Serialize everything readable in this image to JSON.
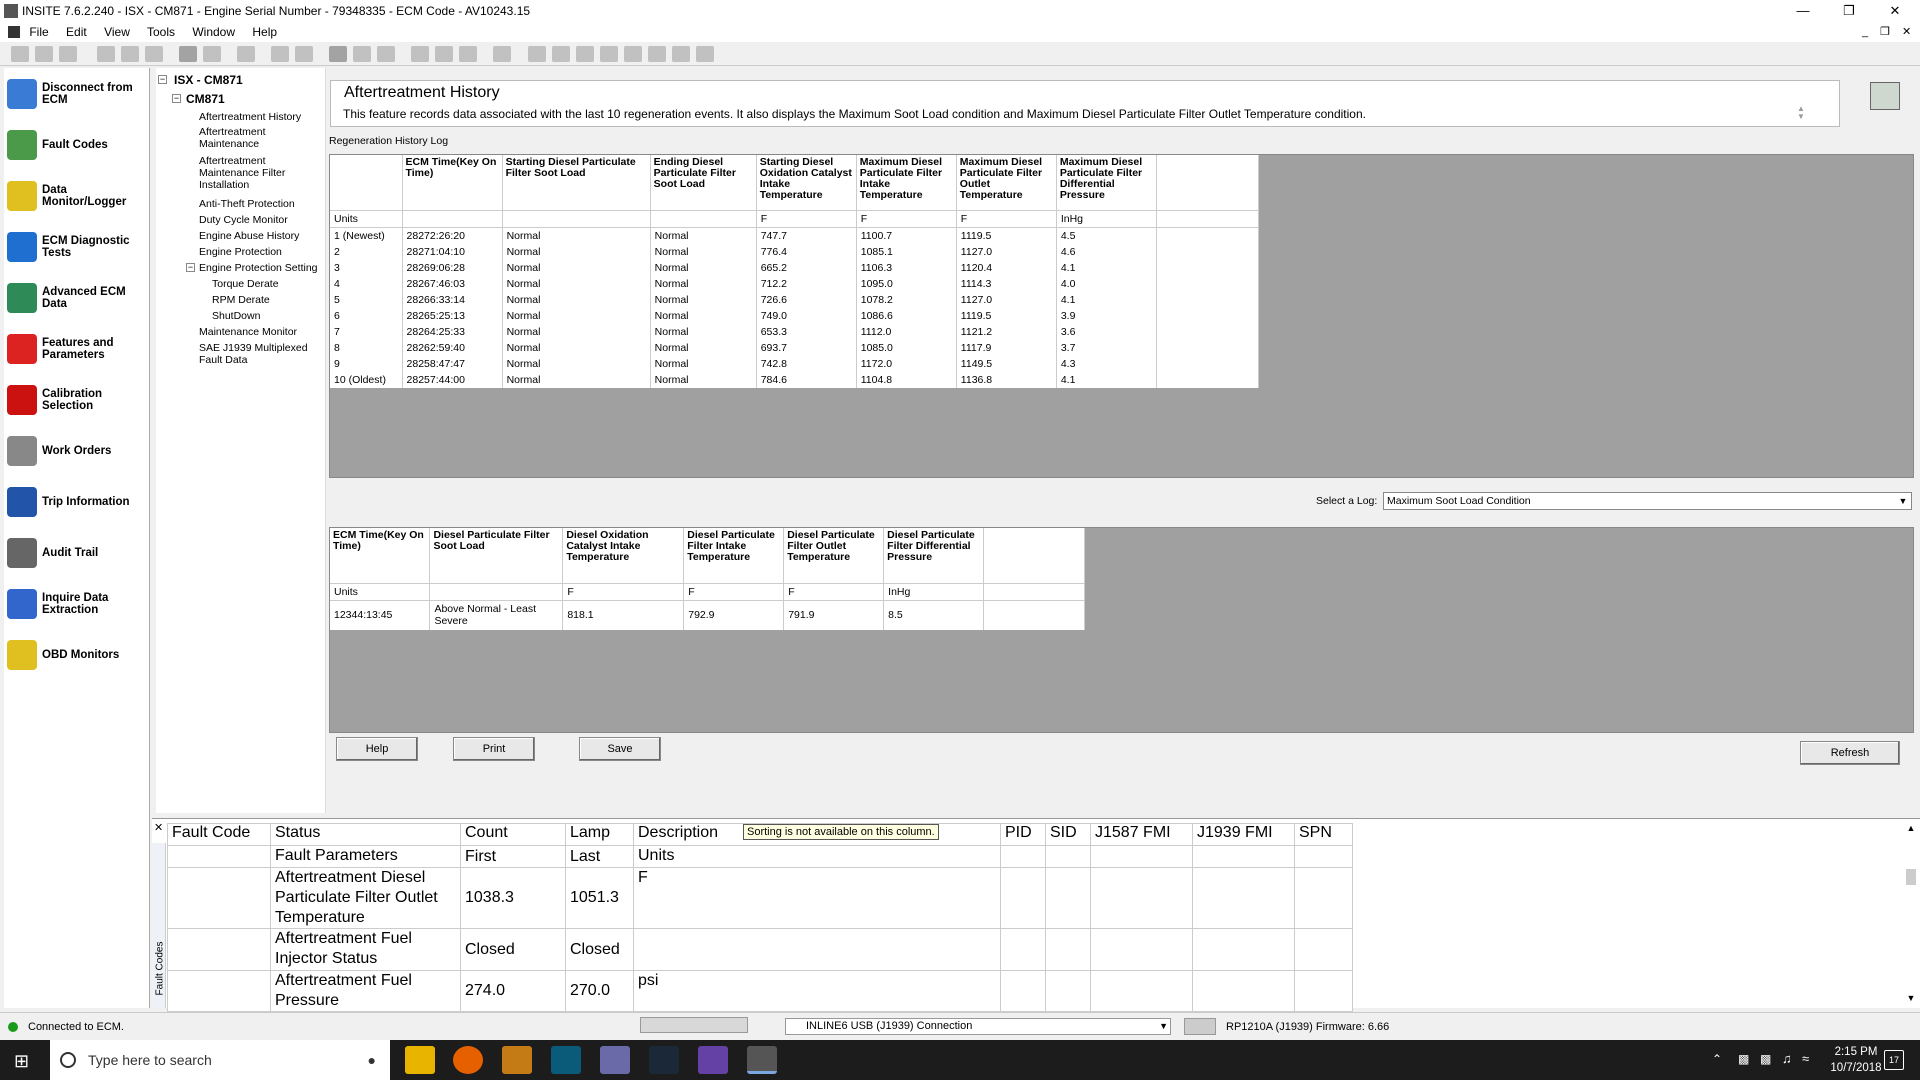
{
  "window": {
    "title": "INSITE 7.6.2.240 - ISX - CM871 - Engine Serial Number - 79348335 - ECM Code - AV10243.15"
  },
  "menu": [
    "File",
    "Edit",
    "View",
    "Tools",
    "Window",
    "Help"
  ],
  "nav": [
    {
      "label": "Disconnect from ECM",
      "icon": "disconnect-icon",
      "color": "#3a7bd5"
    },
    {
      "label": "Fault Codes",
      "icon": "fault-codes-icon",
      "color": "#4a9a4a"
    },
    {
      "label": "Data Monitor/Logger",
      "icon": "data-monitor-icon",
      "color": "#e0c020"
    },
    {
      "label": "ECM Diagnostic Tests",
      "icon": "diagnostic-tests-icon",
      "color": "#1f6fd1"
    },
    {
      "label": "Advanced ECM Data",
      "icon": "advanced-ecm-icon",
      "color": "#2e8b57"
    },
    {
      "label": "Features and Parameters",
      "icon": "features-icon",
      "color": "#d22"
    },
    {
      "label": "Calibration Selection",
      "icon": "calibration-icon",
      "color": "#c11"
    },
    {
      "label": "Work Orders",
      "icon": "work-orders-icon",
      "color": "#888"
    },
    {
      "label": "Trip Information",
      "icon": "trip-info-icon",
      "color": "#2255aa"
    },
    {
      "label": "Audit Trail",
      "icon": "audit-trail-icon",
      "color": "#666"
    },
    {
      "label": "Inquire Data Extraction",
      "icon": "inquire-icon",
      "color": "#3366cc"
    },
    {
      "label": "OBD Monitors",
      "icon": "obd-icon",
      "color": "#e0c020"
    }
  ],
  "tree": {
    "root": "ISX - CM871",
    "child": "CM871",
    "items": [
      "Aftertreatment History",
      "Aftertreatment Maintenance",
      "Aftertreatment Maintenance Filter Installation",
      "Anti-Theft Protection",
      "Duty Cycle Monitor",
      "Engine Abuse History",
      "Engine Protection",
      "Engine Protection Setting",
      "Torque Derate",
      "RPM Derate",
      "ShutDown",
      "Maintenance Monitor",
      "SAE J1939 Multiplexed Fault Data"
    ]
  },
  "page": {
    "title": "Aftertreatment History",
    "desc": "This feature records data associated with the last 10 regeneration events. It also displays the Maximum Soot Load condition and Maximum Diesel Particulate Filter Outlet Temperature condition.",
    "log_label": "Regeneration History Log",
    "select_label": "Select a Log:",
    "select_value": "Maximum Soot Load Condition"
  },
  "regen": {
    "headers": [
      "",
      "ECM Time(Key On Time)",
      "Starting Diesel Particulate Filter Soot Load",
      "Ending Diesel Particulate Filter Soot Load",
      "Starting Diesel Oxidation Catalyst Intake Temperature",
      "Maximum Diesel Particulate Filter Intake Temperature",
      "Maximum Diesel Particulate Filter Outlet Temperature",
      "Maximum Diesel Particulate Filter Differential Pressure",
      ""
    ],
    "units": [
      "Units",
      "",
      "",
      "",
      "F",
      "F",
      "F",
      "InHg",
      ""
    ],
    "rows": [
      [
        "1 (Newest)",
        "28272:26:20",
        "Normal",
        "Normal",
        "747.7",
        "1100.7",
        "1119.5",
        "4.5"
      ],
      [
        "2",
        "28271:04:10",
        "Normal",
        "Normal",
        "776.4",
        "1085.1",
        "1127.0",
        "4.6"
      ],
      [
        "3",
        "28269:06:28",
        "Normal",
        "Normal",
        "665.2",
        "1106.3",
        "1120.4",
        "4.1"
      ],
      [
        "4",
        "28267:46:03",
        "Normal",
        "Normal",
        "712.2",
        "1095.0",
        "1114.3",
        "4.0"
      ],
      [
        "5",
        "28266:33:14",
        "Normal",
        "Normal",
        "726.6",
        "1078.2",
        "1127.0",
        "4.1"
      ],
      [
        "6",
        "28265:25:13",
        "Normal",
        "Normal",
        "749.0",
        "1086.6",
        "1119.5",
        "3.9"
      ],
      [
        "7",
        "28264:25:33",
        "Normal",
        "Normal",
        "653.3",
        "1112.0",
        "1121.2",
        "3.6"
      ],
      [
        "8",
        "28262:59:40",
        "Normal",
        "Normal",
        "693.7",
        "1085.0",
        "1117.9",
        "3.7"
      ],
      [
        "9",
        "28258:47:47",
        "Normal",
        "Normal",
        "742.8",
        "1172.0",
        "1149.5",
        "4.3"
      ],
      [
        "10 (Oldest)",
        "28257:44:00",
        "Normal",
        "Normal",
        "784.6",
        "1104.8",
        "1136.8",
        "4.1"
      ]
    ]
  },
  "soot": {
    "headers": [
      "ECM Time(Key On Time)",
      "Diesel Particulate Filter Soot Load",
      "Diesel Oxidation Catalyst Intake Temperature",
      "Diesel Particulate Filter Intake Temperature",
      "Diesel Particulate Filter Outlet Temperature",
      "Diesel Particulate Filter Differential Pressure",
      ""
    ],
    "units": [
      "Units",
      "",
      "F",
      "F",
      "F",
      "InHg",
      ""
    ],
    "row": [
      "12344:13:45",
      "Above Normal - Least Severe",
      "818.1",
      "792.9",
      "791.9",
      "8.5",
      ""
    ]
  },
  "buttons": {
    "help": "Help",
    "print": "Print",
    "save": "Save",
    "refresh": "Refresh"
  },
  "faults": {
    "headers": [
      "Fault Code",
      "Status",
      "Count",
      "Lamp",
      "Description",
      "PID",
      "SID",
      "J1587 FMI",
      "J1939 FMI",
      "SPN"
    ],
    "tooltip": "Sorting is not available on this column.",
    "sub": [
      "",
      "Fault Parameters",
      "First",
      "Last",
      "Units"
    ],
    "rows": [
      [
        "",
        "Aftertreatment Diesel Particulate Filter Outlet Temperature",
        "1038.3",
        "1051.3",
        "F"
      ],
      [
        "",
        "Aftertreatment Fuel Injector Status",
        "Closed",
        "Closed",
        ""
      ],
      [
        "",
        "Aftertreatment Fuel Pressure",
        "274.0",
        "270.0",
        "psi"
      ]
    ],
    "side_label": "Fault Codes"
  },
  "status": {
    "connected": "Connected to ECM.",
    "adapter": "INLINE6 USB (J1939) Connection",
    "firmware": "RP1210A (J1939)  Firmware: 6.66"
  },
  "taskbar": {
    "search": "Type here to search",
    "time": "2:15 PM",
    "date": "10/7/2018",
    "notif": "17"
  }
}
